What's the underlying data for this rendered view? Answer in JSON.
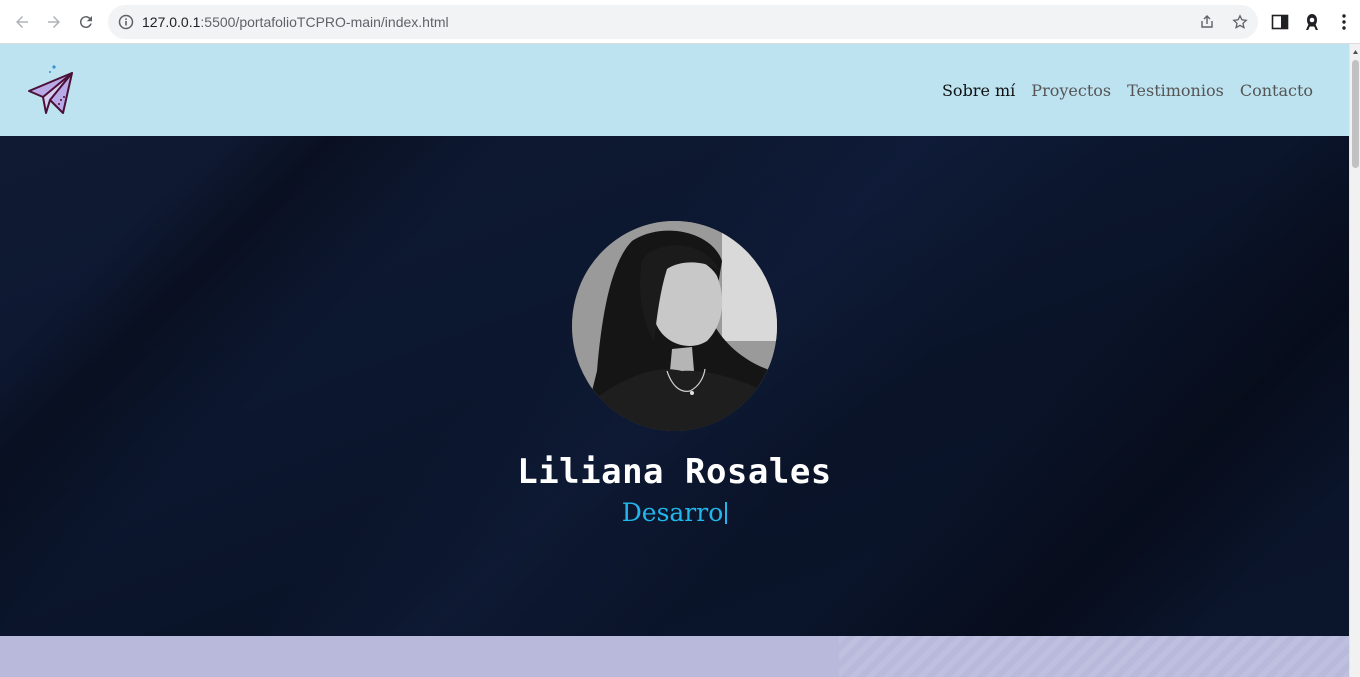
{
  "browser": {
    "url_host": "127.0.0.1",
    "url_rest": ":5500/portafolioTCPRO-main/index.html"
  },
  "nav": {
    "items": [
      {
        "label": "Sobre mí",
        "active": true
      },
      {
        "label": "Proyectos",
        "active": false
      },
      {
        "label": "Testimonios",
        "active": false
      },
      {
        "label": "Contacto",
        "active": false
      }
    ]
  },
  "hero": {
    "name": "Liliana Rosales",
    "role_typing": "Desarro"
  },
  "colors": {
    "header_bg": "#bde2f0",
    "hero_bg": "#0c1730",
    "accent": "#22b6ea",
    "section_bg": "#b8b9db"
  },
  "icons": [
    "back-arrow-icon",
    "forward-arrow-icon",
    "reload-icon",
    "info-icon",
    "share-icon",
    "star-icon",
    "side-panel-icon",
    "profile-icon",
    "kebab-menu-icon",
    "paper-plane-logo-icon"
  ]
}
